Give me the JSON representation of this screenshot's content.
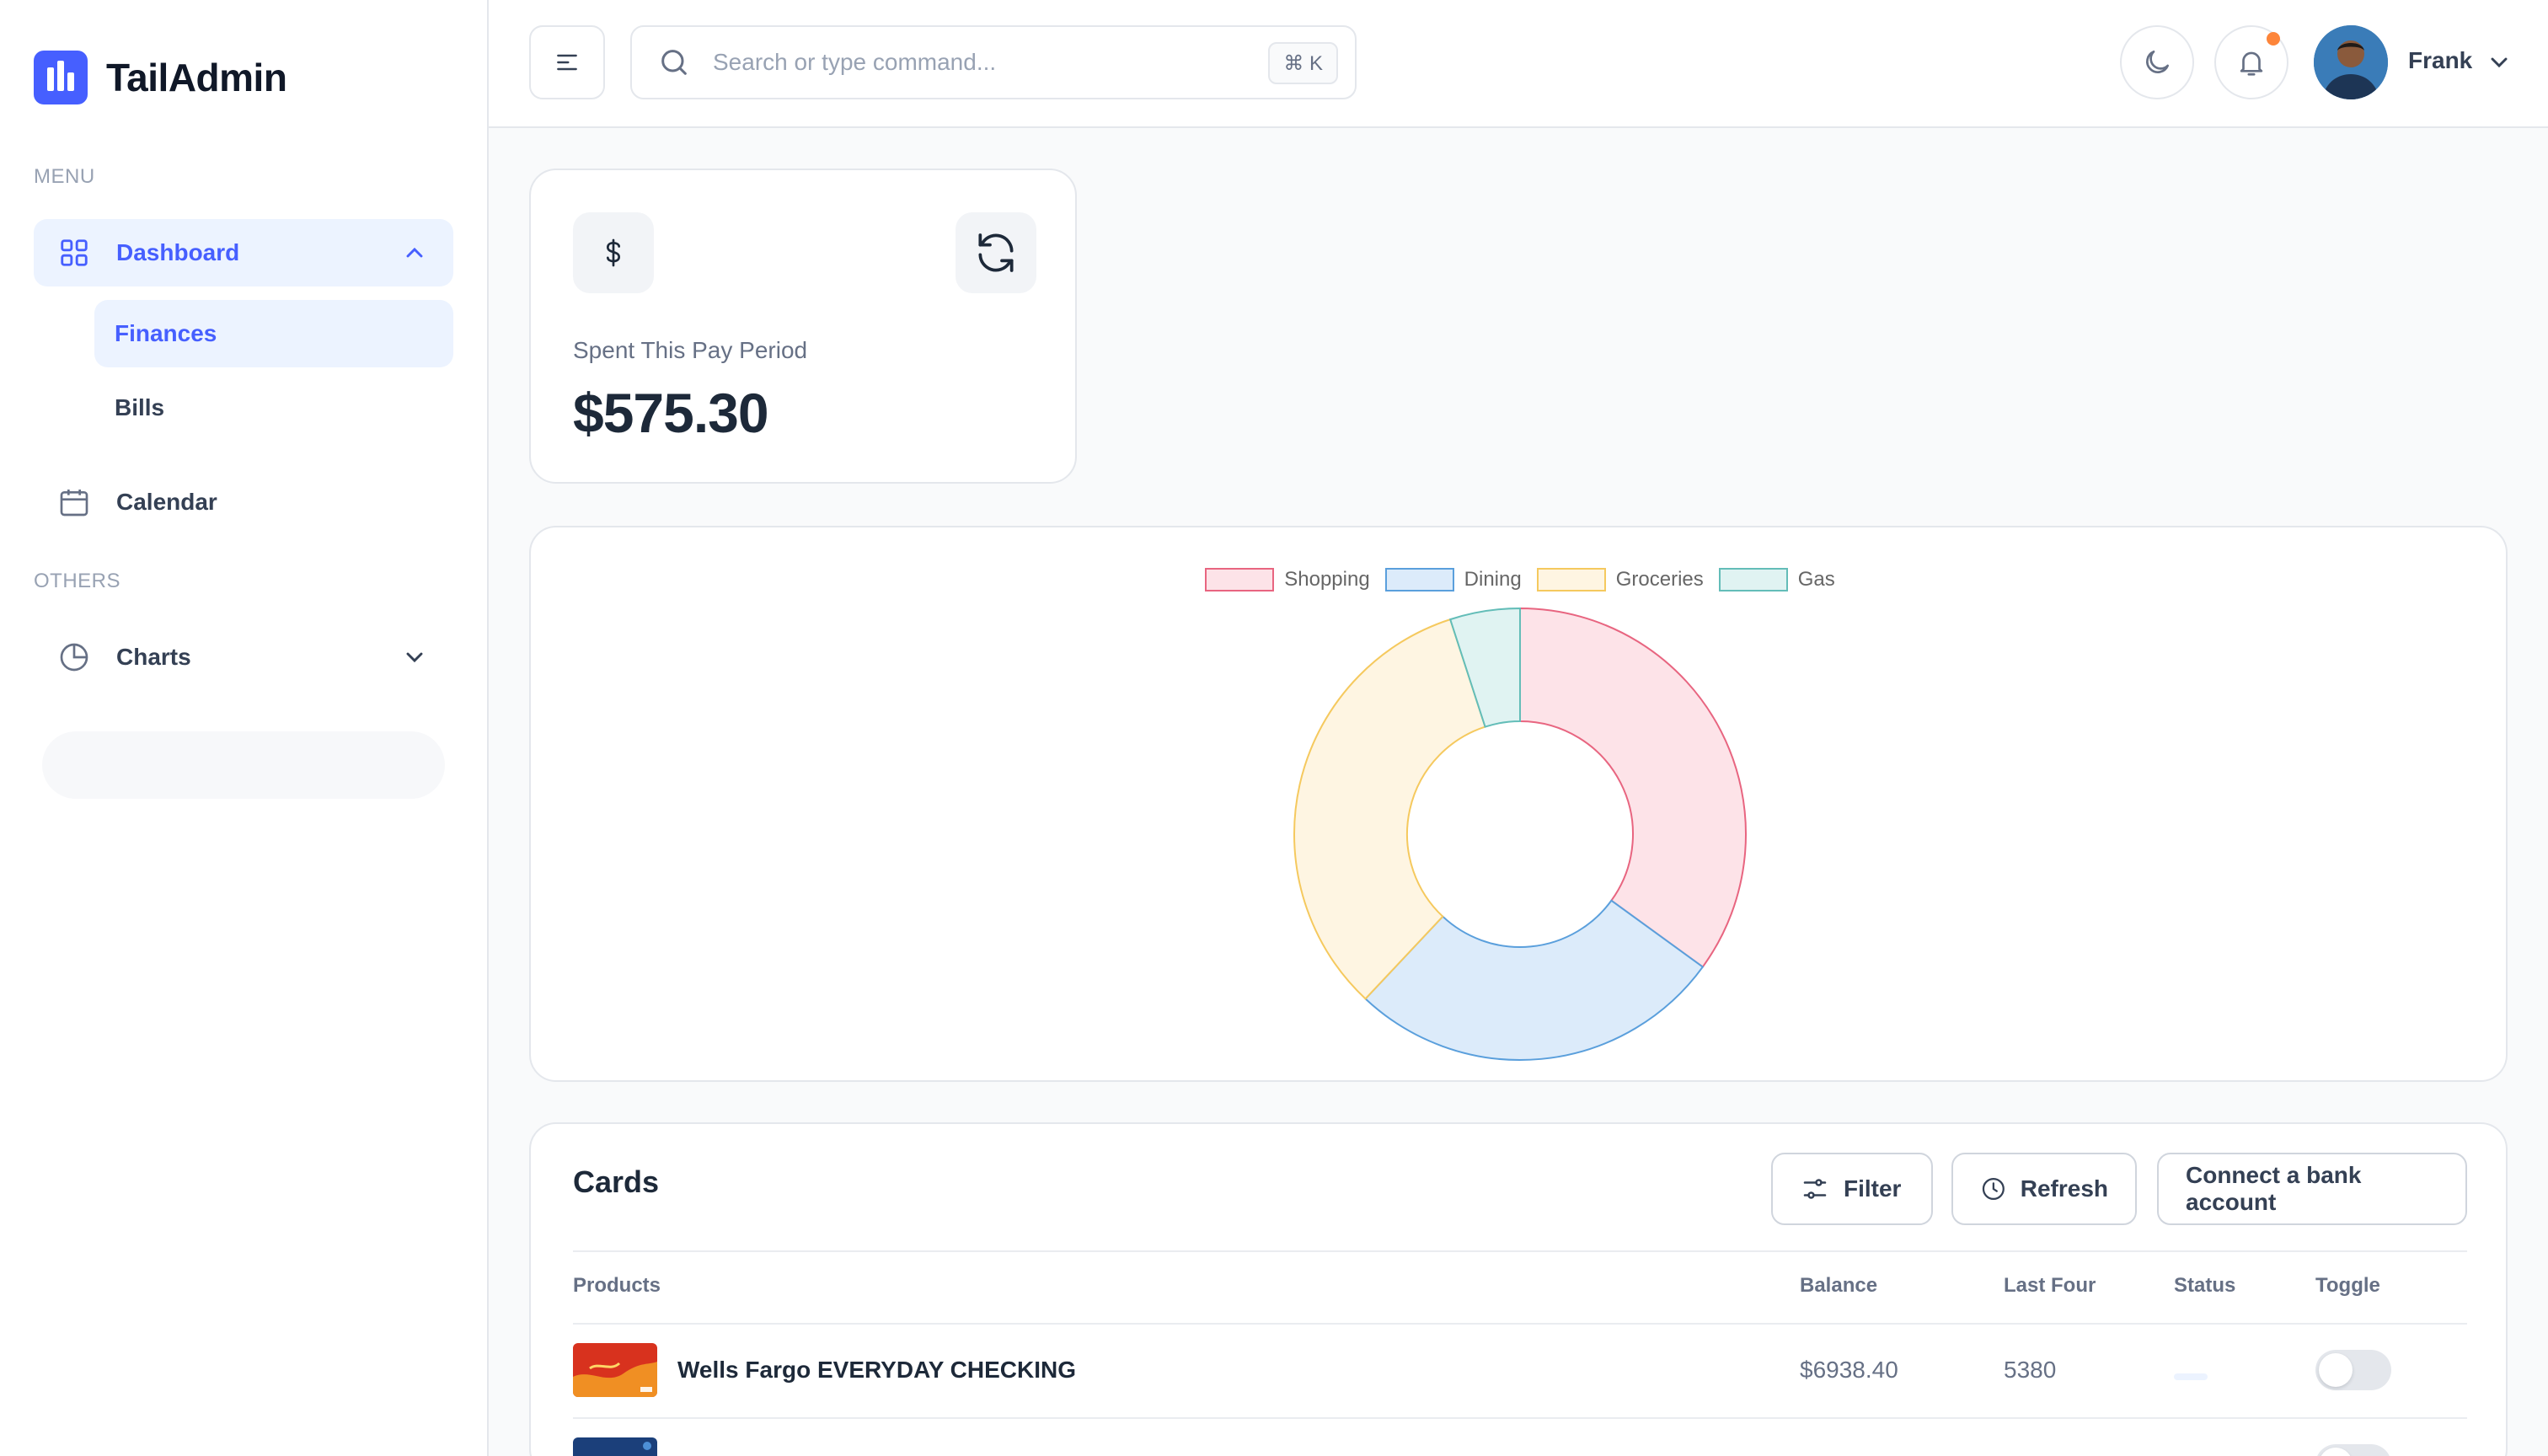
{
  "app": {
    "name": "TailAdmin",
    "brand_color": "#465fff"
  },
  "sidebar": {
    "menu_label": "MENU",
    "others_label": "OTHERS",
    "dashboard": {
      "label": "Dashboard",
      "icon": "grid-icon"
    },
    "sub_items": [
      {
        "label": "Finances",
        "active": true
      },
      {
        "label": "Bills",
        "active": false
      }
    ],
    "calendar": {
      "label": "Calendar",
      "icon": "calendar-icon"
    },
    "charts": {
      "label": "Charts",
      "icon": "pie-chart-icon"
    }
  },
  "header": {
    "search_placeholder": "Search or type command...",
    "search_shortcut": "⌘ K",
    "user_name": "Frank",
    "notification_dot_color": "#fd853a"
  },
  "stat": {
    "label": "Spent This Pay Period",
    "value": "$575.30"
  },
  "chart_data": {
    "type": "pie",
    "categories": [
      "Shopping",
      "Dining",
      "Groceries",
      "Gas"
    ],
    "values": [
      35,
      27,
      33,
      5
    ],
    "colors": {
      "Shopping": {
        "fill": "#fde3e8",
        "stroke": "#e86580"
      },
      "Dining": {
        "fill": "#dcebfa",
        "stroke": "#5a9fdc"
      },
      "Groceries": {
        "fill": "#fef5e2",
        "stroke": "#f5c95e"
      },
      "Gas": {
        "fill": "#e0f3f2",
        "stroke": "#63bdb8"
      }
    },
    "legend_position": "top"
  },
  "cards_section": {
    "title": "Cards",
    "filter_label": "Filter",
    "refresh_label": "Refresh",
    "connect_label": "Connect a bank account",
    "columns": {
      "products": "Products",
      "balance": "Balance",
      "last_four": "Last Four",
      "status": "Status",
      "toggle": "Toggle"
    },
    "rows": [
      {
        "product": "Wells Fargo EVERYDAY CHECKING",
        "balance": "$6938.40",
        "last_four": "5380",
        "enabled": false
      }
    ]
  }
}
